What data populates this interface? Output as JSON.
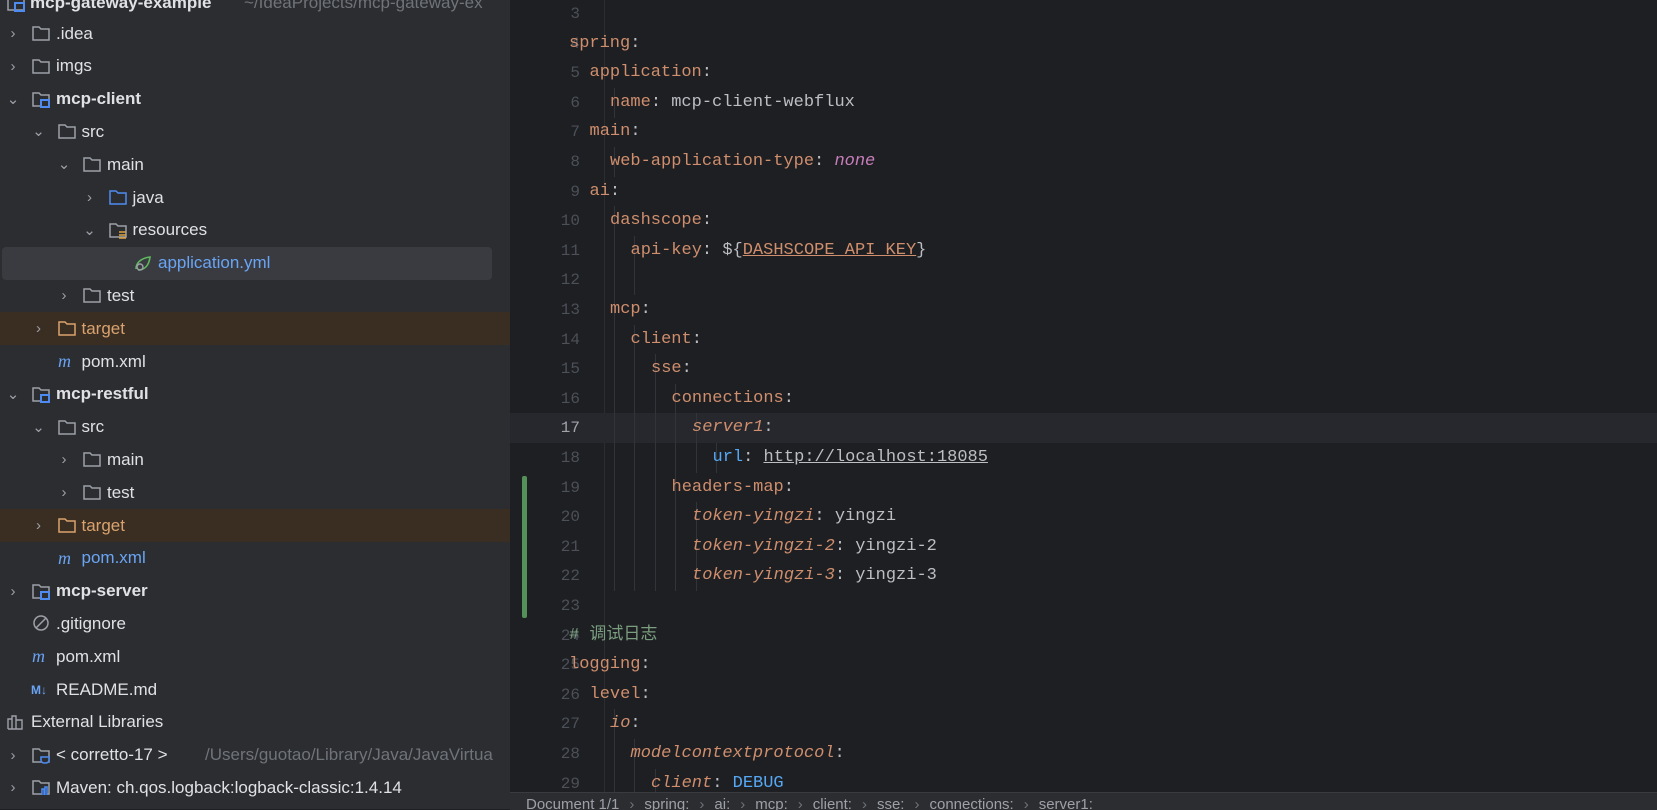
{
  "project_tree": {
    "root": {
      "label": "mcp-gateway-example",
      "path": "~/IdeaProjects/mcp-gateway-ex"
    },
    "items": [
      {
        "label": ".idea",
        "level": 0,
        "chevron": "closed",
        "icon": "folder-icon"
      },
      {
        "label": "imgs",
        "level": 0,
        "chevron": "closed",
        "icon": "folder-icon"
      },
      {
        "label": "mcp-client",
        "level": 0,
        "chevron": "open",
        "icon": "module-folder-icon",
        "bold": true
      },
      {
        "label": "src",
        "level": 1,
        "chevron": "open",
        "icon": "folder-icon"
      },
      {
        "label": "main",
        "level": 2,
        "chevron": "open",
        "icon": "folder-icon"
      },
      {
        "label": "java",
        "level": 3,
        "chevron": "closed",
        "icon": "source-folder-icon"
      },
      {
        "label": "resources",
        "level": 3,
        "chevron": "open",
        "icon": "resources-folder-icon"
      },
      {
        "label": "application.yml",
        "level": 4,
        "chevron": "none",
        "icon": "spring-yaml-icon",
        "selected": true,
        "color": "#6AA4F4"
      },
      {
        "label": "test",
        "level": 2,
        "chevron": "closed",
        "icon": "folder-icon"
      },
      {
        "label": "target",
        "level": 1,
        "chevron": "closed",
        "icon": "excluded-folder-icon",
        "excluded": true,
        "color": "#D9A26E"
      },
      {
        "label": "pom.xml",
        "level": 1,
        "chevron": "none",
        "icon": "maven-icon"
      },
      {
        "label": "mcp-restful",
        "level": 0,
        "chevron": "open",
        "icon": "module-folder-icon",
        "bold": true
      },
      {
        "label": "src",
        "level": 1,
        "chevron": "open",
        "icon": "folder-icon"
      },
      {
        "label": "main",
        "level": 2,
        "chevron": "closed",
        "icon": "folder-icon"
      },
      {
        "label": "test",
        "level": 2,
        "chevron": "closed",
        "icon": "folder-icon"
      },
      {
        "label": "target",
        "level": 1,
        "chevron": "closed",
        "icon": "excluded-folder-icon",
        "excluded": true,
        "color": "#D9A26E"
      },
      {
        "label": "pom.xml",
        "level": 1,
        "chevron": "none",
        "icon": "maven-icon",
        "color": "#6AA4F4"
      },
      {
        "label": "mcp-server",
        "level": 0,
        "chevron": "closed",
        "icon": "module-folder-icon",
        "bold": true
      },
      {
        "label": ".gitignore",
        "level": 0,
        "chevron": "none",
        "icon": "ignore-file-icon"
      },
      {
        "label": "pom.xml",
        "level": 0,
        "chevron": "none",
        "icon": "maven-icon"
      },
      {
        "label": "README.md",
        "level": 0,
        "chevron": "none",
        "icon": "markdown-icon"
      },
      {
        "label": "External Libraries",
        "level": -1,
        "chevron": "none",
        "icon": "libraries-icon"
      },
      {
        "label": "< corretto-17 >",
        "path": "/Users/guotao/Library/Java/JavaVirtua",
        "level": 0,
        "chevron": "closed",
        "icon": "jdk-folder-icon"
      },
      {
        "label": "Maven: ch.qos.logback:logback-classic:1.4.14",
        "level": 0,
        "chevron": "closed",
        "icon": "library-folder-icon"
      }
    ]
  },
  "editor": {
    "current_line": 17,
    "changed_lines": [
      19,
      23
    ],
    "lines": [
      {
        "n": "3",
        "indent": 0,
        "tokens": []
      },
      {
        "n": "4",
        "indent": 0,
        "tokens": [
          {
            "t": "spring",
            "c": "k"
          },
          {
            "t": ":",
            "c": "p"
          }
        ]
      },
      {
        "n": "5",
        "indent": 1,
        "tokens": [
          {
            "t": "application",
            "c": "k"
          },
          {
            "t": ":",
            "c": "p"
          }
        ]
      },
      {
        "n": "6",
        "indent": 2,
        "tokens": [
          {
            "t": "name",
            "c": "k"
          },
          {
            "t": ": ",
            "c": "p"
          },
          {
            "t": "mcp-client-webflux",
            "c": "v"
          }
        ]
      },
      {
        "n": "7",
        "indent": 1,
        "tokens": [
          {
            "t": "main",
            "c": "k"
          },
          {
            "t": ":",
            "c": "p"
          }
        ]
      },
      {
        "n": "8",
        "indent": 2,
        "tokens": [
          {
            "t": "web-application-type",
            "c": "k"
          },
          {
            "t": ": ",
            "c": "p"
          },
          {
            "t": "none",
            "c": "kw"
          }
        ]
      },
      {
        "n": "9",
        "indent": 1,
        "tokens": [
          {
            "t": "ai",
            "c": "k"
          },
          {
            "t": ":",
            "c": "p"
          }
        ]
      },
      {
        "n": "10",
        "indent": 2,
        "tokens": [
          {
            "t": "dashscope",
            "c": "k"
          },
          {
            "t": ":",
            "c": "p"
          }
        ]
      },
      {
        "n": "11",
        "indent": 3,
        "tokens": [
          {
            "t": "api-key",
            "c": "k"
          },
          {
            "t": ": ${",
            "c": "p"
          },
          {
            "t": "DASHSCOPE_API_KEY",
            "c": "ku"
          },
          {
            "t": "}",
            "c": "p"
          }
        ]
      },
      {
        "n": "12",
        "indent": 0,
        "guides": 2,
        "tokens": []
      },
      {
        "n": "13",
        "indent": 2,
        "tokens": [
          {
            "t": "mcp",
            "c": "k"
          },
          {
            "t": ":",
            "c": "p"
          }
        ]
      },
      {
        "n": "14",
        "indent": 3,
        "tokens": [
          {
            "t": "client",
            "c": "k"
          },
          {
            "t": ":",
            "c": "p"
          }
        ]
      },
      {
        "n": "15",
        "indent": 4,
        "tokens": [
          {
            "t": "sse",
            "c": "k"
          },
          {
            "t": ":",
            "c": "p"
          }
        ]
      },
      {
        "n": "16",
        "indent": 5,
        "tokens": [
          {
            "t": "connections",
            "c": "k"
          },
          {
            "t": ":",
            "c": "p"
          }
        ]
      },
      {
        "n": "17",
        "indent": 6,
        "tokens": [
          {
            "t": "server1",
            "c": "ki"
          },
          {
            "t": ":",
            "c": "p"
          }
        ]
      },
      {
        "n": "18",
        "indent": 7,
        "tokens": [
          {
            "t": "url",
            "c": "b"
          },
          {
            "t": ": ",
            "c": "p"
          },
          {
            "t": "http://localhost:18085",
            "c": "u"
          }
        ]
      },
      {
        "n": "19",
        "indent": 5,
        "tokens": [
          {
            "t": "headers-map",
            "c": "k"
          },
          {
            "t": ":",
            "c": "p"
          }
        ]
      },
      {
        "n": "20",
        "indent": 6,
        "tokens": [
          {
            "t": "token-yingzi",
            "c": "ki"
          },
          {
            "t": ": ",
            "c": "p"
          },
          {
            "t": "yingzi",
            "c": "v"
          }
        ]
      },
      {
        "n": "21",
        "indent": 6,
        "tokens": [
          {
            "t": "token-yingzi-2",
            "c": "ki"
          },
          {
            "t": ": ",
            "c": "p"
          },
          {
            "t": "yingzi-2",
            "c": "v"
          }
        ]
      },
      {
        "n": "22",
        "indent": 6,
        "tokens": [
          {
            "t": "token-yingzi-3",
            "c": "ki"
          },
          {
            "t": ": ",
            "c": "p"
          },
          {
            "t": "yingzi-3",
            "c": "v"
          }
        ]
      },
      {
        "n": "23",
        "indent": 0,
        "tokens": []
      },
      {
        "n": "24",
        "indent": 0,
        "tokens": [
          {
            "t": "# 调试日志",
            "c": "c"
          }
        ]
      },
      {
        "n": "25",
        "indent": 0,
        "tokens": [
          {
            "t": "logging",
            "c": "k"
          },
          {
            "t": ":",
            "c": "p"
          }
        ]
      },
      {
        "n": "26",
        "indent": 1,
        "tokens": [
          {
            "t": "level",
            "c": "k"
          },
          {
            "t": ":",
            "c": "p"
          }
        ]
      },
      {
        "n": "27",
        "indent": 2,
        "tokens": [
          {
            "t": "io",
            "c": "ki"
          },
          {
            "t": ":",
            "c": "p"
          }
        ]
      },
      {
        "n": "28",
        "indent": 3,
        "tokens": [
          {
            "t": "modelcontextprotocol",
            "c": "ki"
          },
          {
            "t": ":",
            "c": "p"
          }
        ]
      },
      {
        "n": "29",
        "indent": 4,
        "tokens": [
          {
            "t": "client",
            "c": "ki"
          },
          {
            "t": ": ",
            "c": "p"
          },
          {
            "t": "DEBUG",
            "c": "b"
          }
        ]
      }
    ]
  },
  "status_bar": {
    "breadcrumbs": [
      "Document 1/1",
      "spring:",
      "ai:",
      "mcp:",
      "client:",
      "sse:",
      "connections:",
      "server1:"
    ]
  },
  "colors": {
    "sidebar_bg": "#2B2D30",
    "editor_bg": "#1E1F22",
    "key": "#CF8E6D",
    "change_bar": "#549159"
  }
}
